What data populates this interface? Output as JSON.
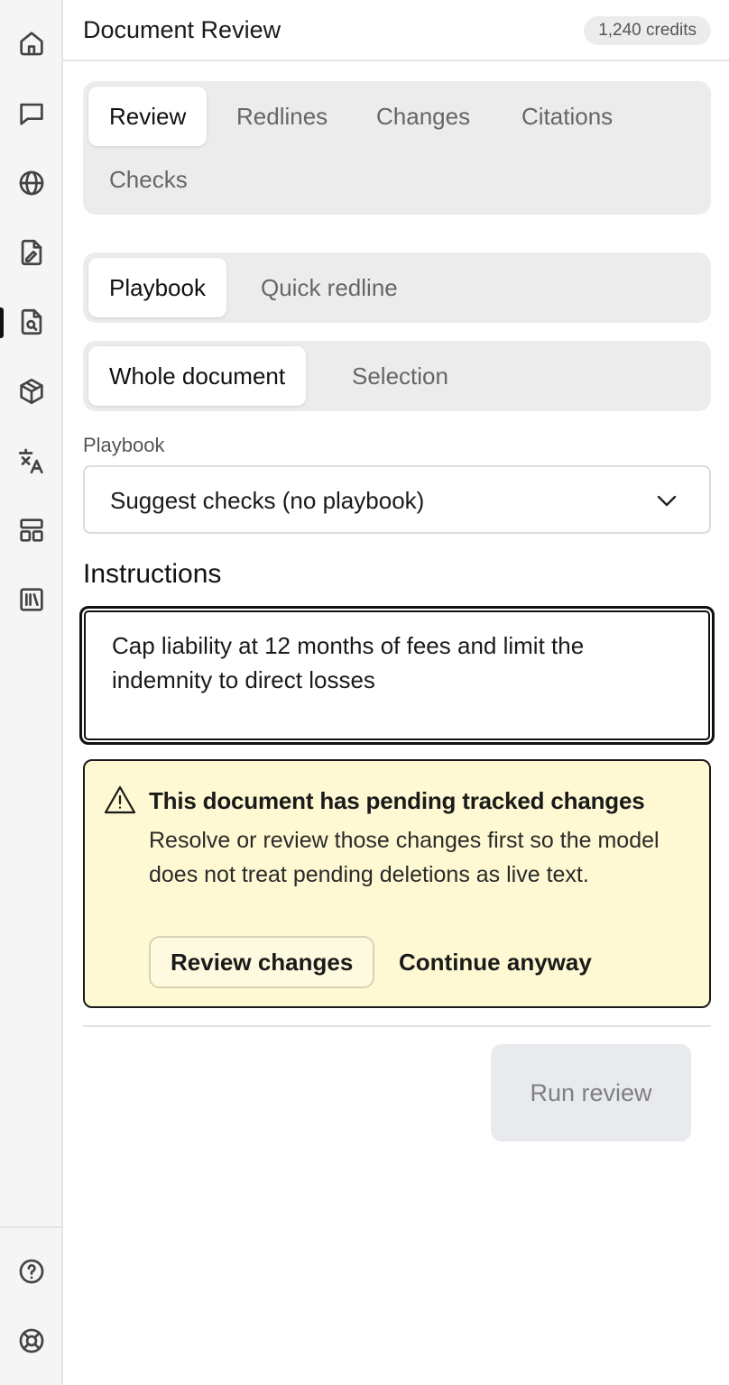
{
  "header": {
    "title": "Document Review",
    "credits": "1,240 credits"
  },
  "rail": {
    "items": [
      {
        "icon": "home-icon"
      },
      {
        "icon": "chat-icon"
      },
      {
        "icon": "globe-icon"
      },
      {
        "icon": "file-edit-icon"
      },
      {
        "icon": "file-search-icon",
        "active": true
      },
      {
        "icon": "cube-icon"
      },
      {
        "icon": "translate-icon"
      },
      {
        "icon": "layout-icon"
      },
      {
        "icon": "library-icon"
      }
    ],
    "bottom": [
      {
        "icon": "help-icon"
      },
      {
        "icon": "lifebuoy-icon"
      }
    ]
  },
  "mode_tabs": [
    "Review",
    "Redlines",
    "Changes",
    "Citations",
    "Checks"
  ],
  "active_mode_tab": "Review",
  "source_tabs": [
    "Playbook",
    "Quick redline"
  ],
  "active_source_tab": "Playbook",
  "scope_tabs": [
    "Whole document",
    "Selection"
  ],
  "active_scope_tab": "Whole document",
  "playbook": {
    "label": "Playbook",
    "value": "Suggest checks (no playbook)"
  },
  "instructions": {
    "label": "Instructions",
    "value": "Cap liability at 12 months of fees and limit the indemnity to direct losses"
  },
  "alert": {
    "title": "This document has pending tracked changes",
    "body": "Resolve or review those changes first so the model does not treat pending deletions as live text.",
    "primary": "Review changes",
    "secondary": "Continue anyway",
    "background": "#fef9d2"
  },
  "run_button": "Run review"
}
